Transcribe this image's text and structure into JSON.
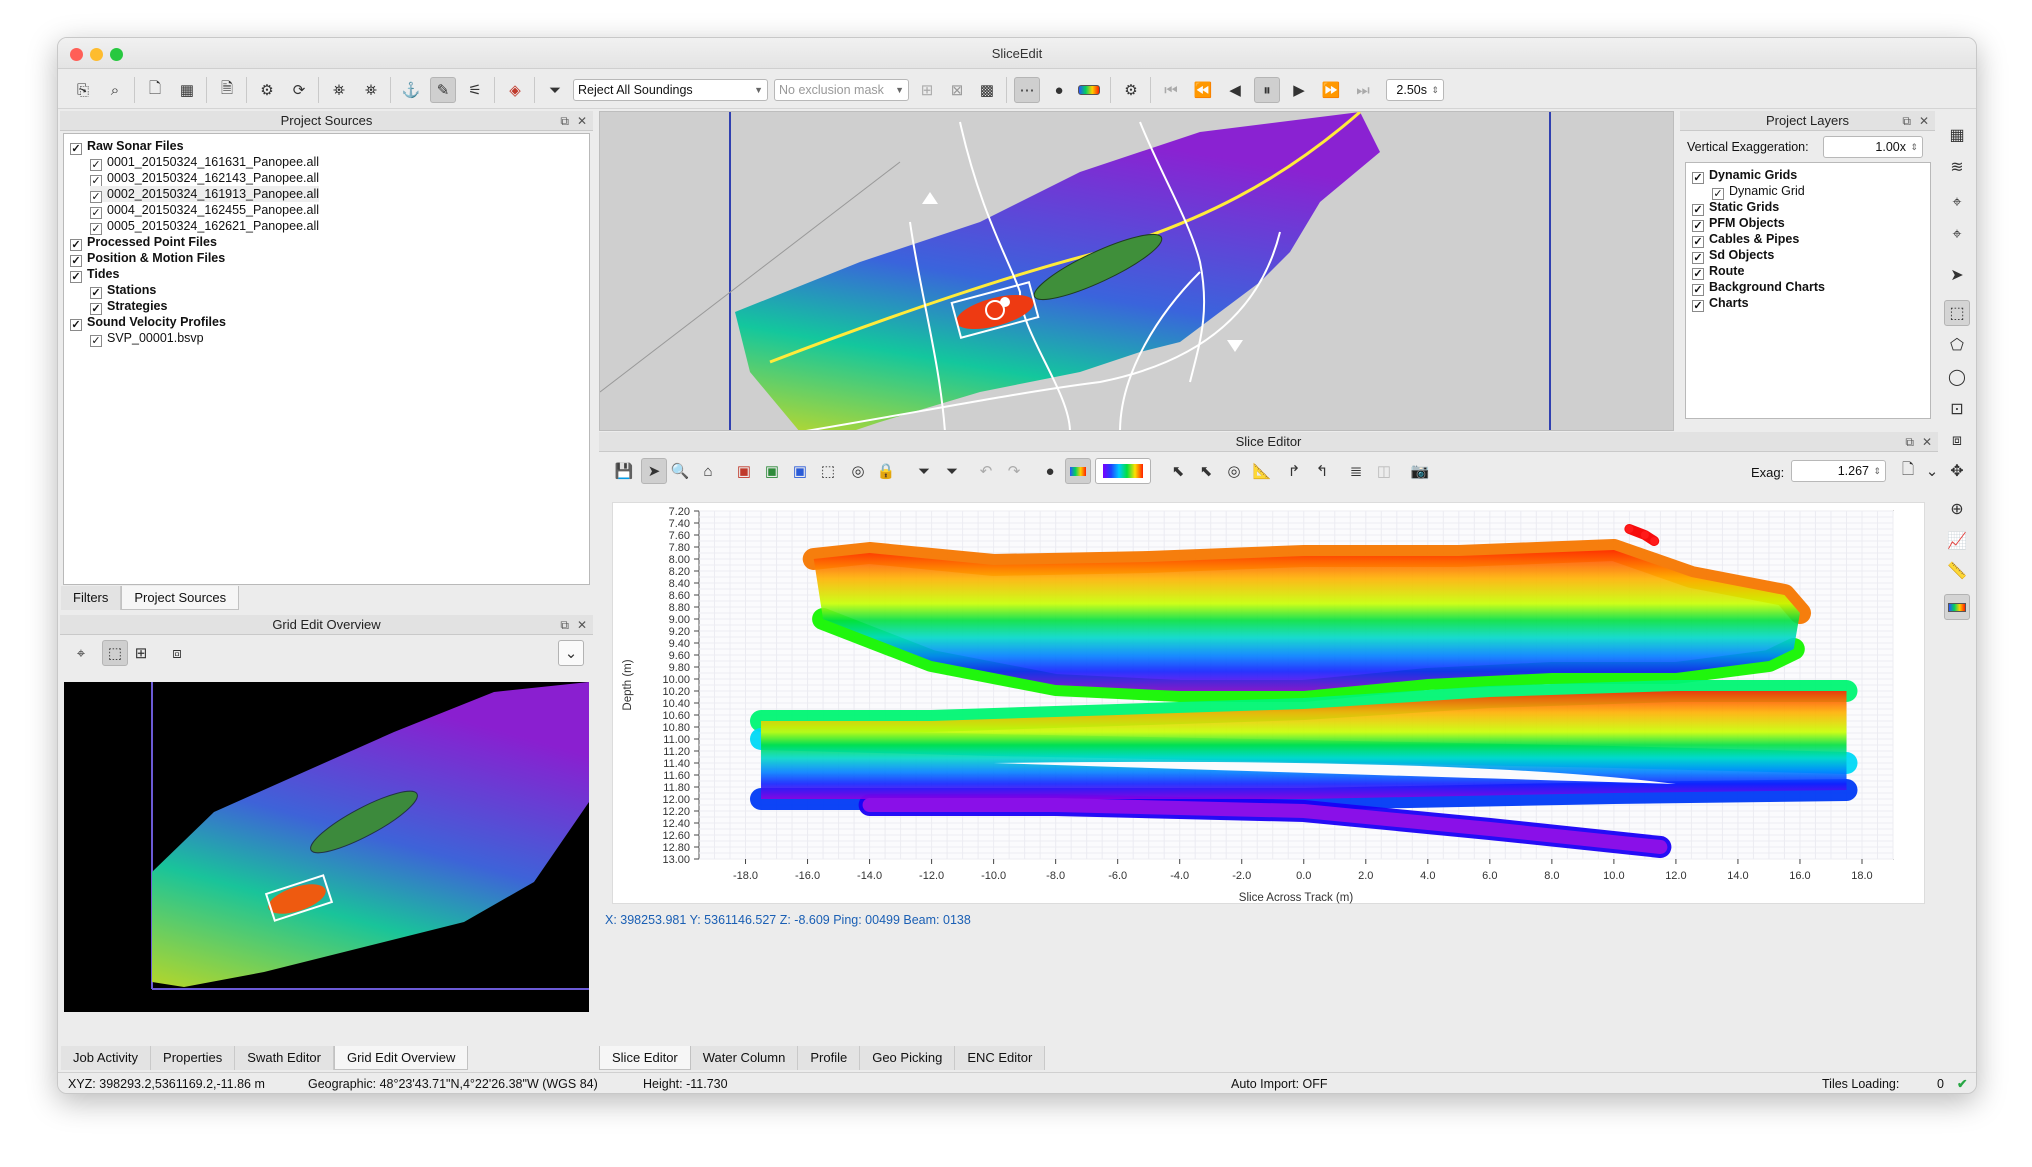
{
  "window": {
    "title": "SliceEdit"
  },
  "toolbar": {
    "reject_combo": "Reject All Soundings",
    "mask_combo": "No exclusion mask",
    "interval": "2.50s"
  },
  "project_sources": {
    "title": "Project Sources",
    "items": [
      {
        "label": "Raw Sonar Files",
        "level": 0,
        "bold": true
      },
      {
        "label": "0001_20150324_161631_Panopee.all",
        "level": 1,
        "bold": false
      },
      {
        "label": "0003_20150324_162143_Panopee.all",
        "level": 1,
        "bold": false
      },
      {
        "label": "0002_20150324_161913_Panopee.all",
        "level": 1,
        "bold": false
      },
      {
        "label": "0004_20150324_162455_Panopee.all",
        "level": 1,
        "bold": false
      },
      {
        "label": "0005_20150324_162621_Panopee.all",
        "level": 1,
        "bold": false
      },
      {
        "label": "Processed Point Files",
        "level": 0,
        "bold": true
      },
      {
        "label": "Position & Motion Files",
        "level": 0,
        "bold": true
      },
      {
        "label": "Tides",
        "level": 0,
        "bold": true
      },
      {
        "label": "Stations",
        "level": 1,
        "bold": true
      },
      {
        "label": "Strategies",
        "level": 1,
        "bold": true
      },
      {
        "label": "Sound Velocity Profiles",
        "level": 0,
        "bold": true
      },
      {
        "label": "SVP_00001.bsvp",
        "level": 1,
        "bold": false
      }
    ]
  },
  "left_tabs1": [
    "Filters",
    "Project Sources"
  ],
  "grid_overview": {
    "title": "Grid Edit Overview"
  },
  "left_tabs2": [
    "Job Activity",
    "Properties",
    "Swath Editor",
    "Grid Edit Overview"
  ],
  "project_layers": {
    "title": "Project Layers",
    "vexag_label": "Vertical Exaggeration:",
    "vexag_value": "1.00x",
    "items": [
      {
        "label": "Dynamic Grids",
        "level": 0,
        "bold": true
      },
      {
        "label": "Dynamic Grid",
        "level": 1,
        "bold": false
      },
      {
        "label": "Static Grids",
        "level": 0,
        "bold": true
      },
      {
        "label": "PFM Objects",
        "level": 0,
        "bold": true
      },
      {
        "label": "Cables & Pipes",
        "level": 0,
        "bold": true
      },
      {
        "label": "Sd Objects",
        "level": 0,
        "bold": true
      },
      {
        "label": "Route",
        "level": 0,
        "bold": true
      },
      {
        "label": "Background Charts",
        "level": 0,
        "bold": true
      },
      {
        "label": "Charts",
        "level": 0,
        "bold": true
      }
    ]
  },
  "slice_editor": {
    "title": "Slice Editor",
    "exag_label": "Exag:",
    "exag_value": "1.267",
    "coords": "X: 398253.981 Y: 5361146.527 Z: -8.609  Ping: 00499 Beam: 0138"
  },
  "bottom_tabs": [
    "Slice Editor",
    "Water Column",
    "Profile",
    "Geo Picking",
    "ENC Editor"
  ],
  "status": {
    "xyz": "XYZ: 398293.2,5361169.2,-11.86 m",
    "geo": "Geographic: 48°23'43.71\"N,4°22'26.38\"W (WGS 84)",
    "height": "Height: -11.730",
    "auto_import": "Auto Import: OFF",
    "tiles_label": "Tiles Loading:",
    "tiles_value": "0"
  },
  "chart_data": {
    "type": "scatter",
    "xlabel": "Slice Across Track (m)",
    "ylabel": "Depth (m)",
    "xlim": [
      -19.5,
      19
    ],
    "ylim": [
      7.2,
      13.0
    ],
    "xticks": [
      "-18.0",
      "-16.0",
      "-14.0",
      "-12.0",
      "-10.0",
      "-8.0",
      "-6.0",
      "-4.0",
      "-2.0",
      "0.0",
      "2.0",
      "4.0",
      "6.0",
      "8.0",
      "10.0",
      "12.0",
      "14.0",
      "16.0",
      "18.0"
    ],
    "yticks": [
      "7.20",
      "7.40",
      "7.60",
      "7.80",
      "8.00",
      "8.20",
      "8.40",
      "8.60",
      "8.80",
      "9.00",
      "9.20",
      "9.40",
      "9.60",
      "9.80",
      "10.00",
      "10.20",
      "10.40",
      "10.60",
      "10.80",
      "11.00",
      "11.20",
      "11.40",
      "11.60",
      "11.80",
      "12.00",
      "12.20",
      "12.40",
      "12.60",
      "12.80",
      "13.00"
    ],
    "grid": true,
    "colormap": "depth rainbow (red shallow to violet deep)",
    "series": [
      {
        "points": [
          [
            -15.8,
            8.0
          ],
          [
            -14,
            7.9
          ],
          [
            -10,
            8.1
          ],
          [
            -5,
            8.05
          ],
          [
            0,
            7.95
          ],
          [
            5,
            7.95
          ],
          [
            10,
            7.85
          ],
          [
            12.5,
            8.3
          ],
          [
            15.5,
            8.6
          ],
          [
            16,
            8.9
          ]
        ]
      },
      {
        "points": [
          [
            -15.5,
            9.0
          ],
          [
            -12,
            9.7
          ],
          [
            -8,
            10.1
          ],
          [
            -4,
            10.2
          ],
          [
            0,
            10.2
          ],
          [
            4,
            10.0
          ],
          [
            8,
            9.9
          ],
          [
            12,
            9.9
          ],
          [
            15,
            9.7
          ],
          [
            15.8,
            9.5
          ]
        ]
      },
      {
        "points": [
          [
            -17.5,
            10.7
          ],
          [
            -12,
            10.7
          ],
          [
            -6,
            10.6
          ],
          [
            0,
            10.5
          ],
          [
            6,
            10.3
          ],
          [
            12,
            10.2
          ],
          [
            17.5,
            10.2
          ]
        ]
      },
      {
        "points": [
          [
            -17.5,
            11.0
          ],
          [
            -10,
            11.1
          ],
          [
            0,
            11.2
          ],
          [
            10,
            11.3
          ],
          [
            17.5,
            11.4
          ]
        ]
      },
      {
        "points": [
          [
            -17.5,
            12.0
          ],
          [
            -10,
            12.0
          ],
          [
            0,
            12.0
          ],
          [
            10,
            11.9
          ],
          [
            17.5,
            11.85
          ]
        ]
      },
      {
        "points": [
          [
            -14,
            12.1
          ],
          [
            -8,
            12.1
          ],
          [
            0,
            12.2
          ],
          [
            6,
            12.5
          ],
          [
            11.5,
            12.8
          ]
        ]
      },
      {
        "points": [
          [
            10.5,
            7.5
          ],
          [
            11,
            7.6
          ],
          [
            11.3,
            7.7
          ]
        ]
      }
    ]
  }
}
